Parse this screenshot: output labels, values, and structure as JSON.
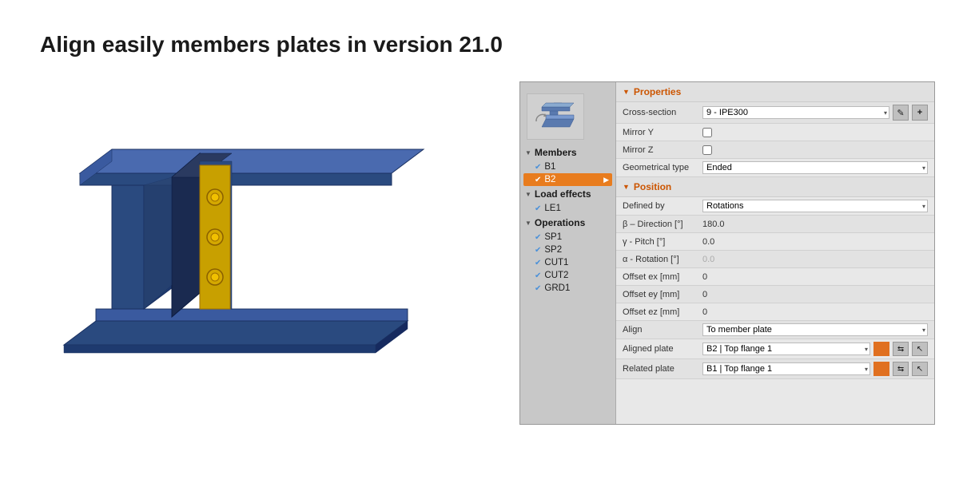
{
  "page": {
    "title": "Align easily members plates in version 21.0"
  },
  "tree": {
    "members_label": "Members",
    "b1_label": "B1",
    "b2_label": "B2",
    "load_effects_label": "Load effects",
    "le1_label": "LE1",
    "operations_label": "Operations",
    "sp1_label": "SP1",
    "sp2_label": "SP2",
    "cut1_label": "CUT1",
    "cut2_label": "CUT2",
    "grd1_label": "GRD1"
  },
  "properties": {
    "section_label": "Properties",
    "cross_section_label": "Cross-section",
    "cross_section_value": "9 - IPE300",
    "mirror_y_label": "Mirror Y",
    "mirror_z_label": "Mirror Z",
    "geometrical_type_label": "Geometrical type",
    "geometrical_type_value": "Ended",
    "position_label": "Position",
    "defined_by_label": "Defined by",
    "defined_by_value": "Rotations",
    "direction_label": "β – Direction [°]",
    "direction_value": "180.0",
    "pitch_label": "γ - Pitch [°]",
    "pitch_value": "0.0",
    "rotation_label": "α - Rotation [°]",
    "rotation_value": "0.0",
    "offset_ex_label": "Offset ex [mm]",
    "offset_ex_value": "0",
    "offset_ey_label": "Offset ey [mm]",
    "offset_ey_value": "0",
    "offset_ez_label": "Offset ez [mm]",
    "offset_ez_value": "0",
    "align_label": "Align",
    "align_value": "To member plate",
    "aligned_plate_label": "Aligned plate",
    "aligned_plate_value": "B2 | Top flange 1",
    "related_plate_label": "Related plate",
    "related_plate_value": "B1 | Top flange 1"
  },
  "icons": {
    "edit": "✎",
    "add": "+",
    "arrow_down": "▾",
    "triangle_right": "▶",
    "triangle_down": "▼",
    "check": "✔",
    "cursor": "↖"
  }
}
